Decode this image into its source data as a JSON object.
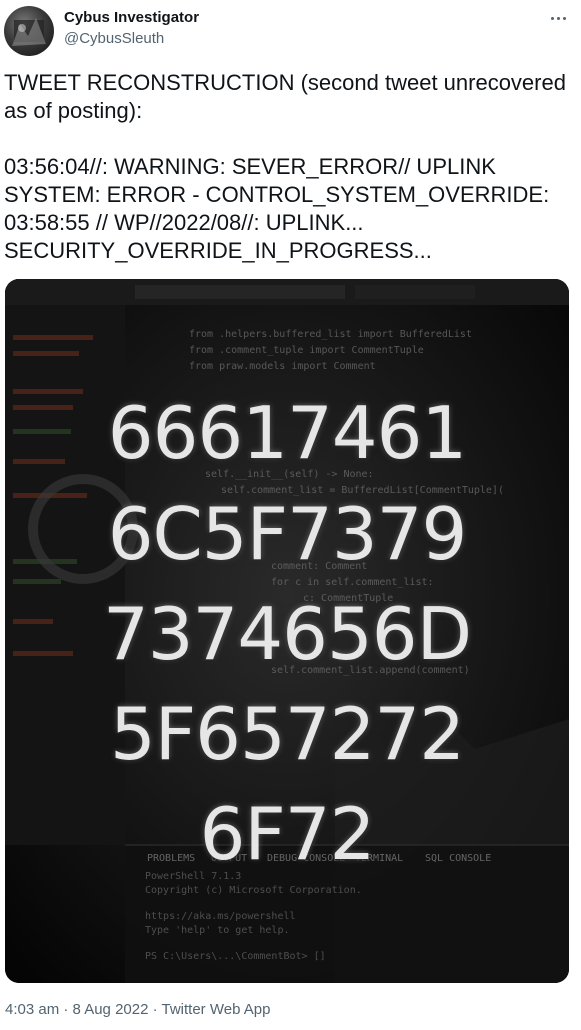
{
  "author": {
    "display_name": "Cybus Investigator",
    "handle": "@CybusSleuth"
  },
  "tweet": {
    "text": "TWEET RECONSTRUCTION (second tweet unrecovered as of posting):\n\n03:56:04//: WARNING: SEVER_ERROR// UPLINK SYSTEM: ERROR - CONTROL_SYSTEM_OVERRIDE: 03:58:55 // WP//2022/08//: UPLINK... SECURITY_OVERRIDE_IN_PROGRESS...",
    "timestamp": "4:03 am · 8 Aug 2022 · Twitter Web App"
  },
  "media": {
    "hex_lines": [
      "66617461",
      "6C5F7379",
      "7374656D",
      "5F657272",
      "6F72"
    ],
    "code_lines": [
      "from .helpers.buffered_list import BufferedList",
      "from .comment_tuple import CommentTuple",
      "from praw.models import Comment",
      "self.__init__(self) -> None:",
      "self.comment_list = BufferedList[CommentTuple](",
      "comment: Comment",
      "for c in self.comment_list:",
      "c: CommentTuple",
      "self.comment_list.append(comment)"
    ],
    "terminal_tabs": [
      "PROBLEMS",
      "OUTPUT",
      "DEBUG CONSOLE",
      "TERMINAL",
      "SQL CONSOLE"
    ],
    "terminal_lines": [
      "PowerShell 7.1.3",
      "Copyright (c) Microsoft Corporation.",
      "https://aka.ms/powershell",
      "Type 'help' to get help.",
      "PS C:\\Users\\...\\CommentBot> []"
    ]
  }
}
